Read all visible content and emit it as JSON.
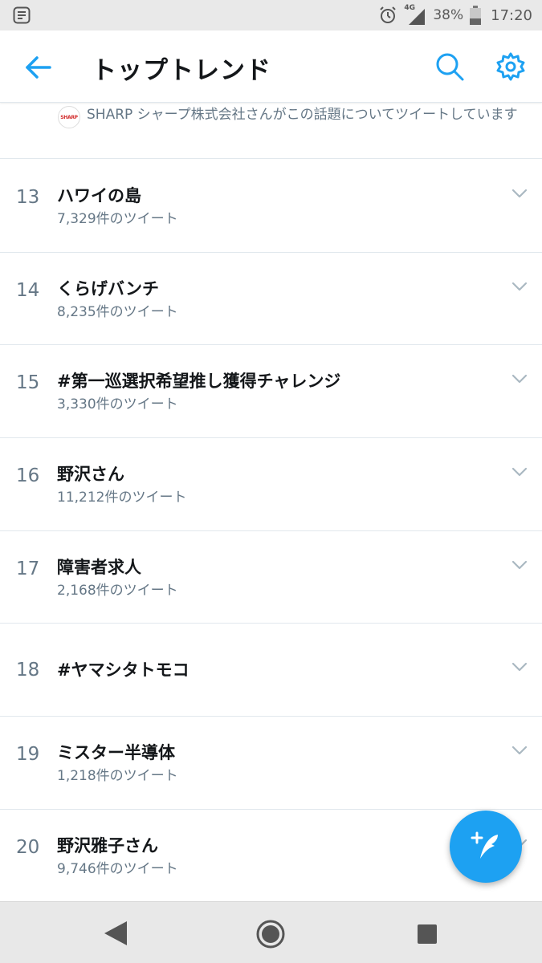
{
  "status_bar": {
    "network": "4G",
    "battery_percent": "38%",
    "time": "17:20",
    "battery_level": 0.38
  },
  "app_bar": {
    "title": "トップトレンド",
    "icons": [
      "back-arrow-icon",
      "search-icon",
      "gear-icon"
    ],
    "accent_color": "#1da1f2"
  },
  "promoted": {
    "logo_text": "SHARP",
    "text": "SHARP シャープ株式会社さんがこの話題についてツイートしています"
  },
  "trends": [
    {
      "rank": "13",
      "name": "ハワイの島",
      "count": "7,329件のツイート"
    },
    {
      "rank": "14",
      "name": "くらげバンチ",
      "count": "8,235件のツイート"
    },
    {
      "rank": "15",
      "name": "#第一巡選択希望推し獲得チャレンジ",
      "count": "3,330件のツイート"
    },
    {
      "rank": "16",
      "name": "野沢さん",
      "count": "11,212件のツイート"
    },
    {
      "rank": "17",
      "name": "障害者求人",
      "count": "2,168件のツイート"
    },
    {
      "rank": "18",
      "name": "#ヤマシタトモコ",
      "count": ""
    },
    {
      "rank": "19",
      "name": "ミスター半導体",
      "count": "1,218件のツイート"
    },
    {
      "rank": "20",
      "name": "野沢雅子さん",
      "count": "9,746件のツイート"
    }
  ],
  "fab": {
    "icon": "compose-tweet-icon"
  },
  "nav_bar": {
    "icons": [
      "nav-back-icon",
      "nav-home-icon",
      "nav-recents-icon"
    ]
  }
}
